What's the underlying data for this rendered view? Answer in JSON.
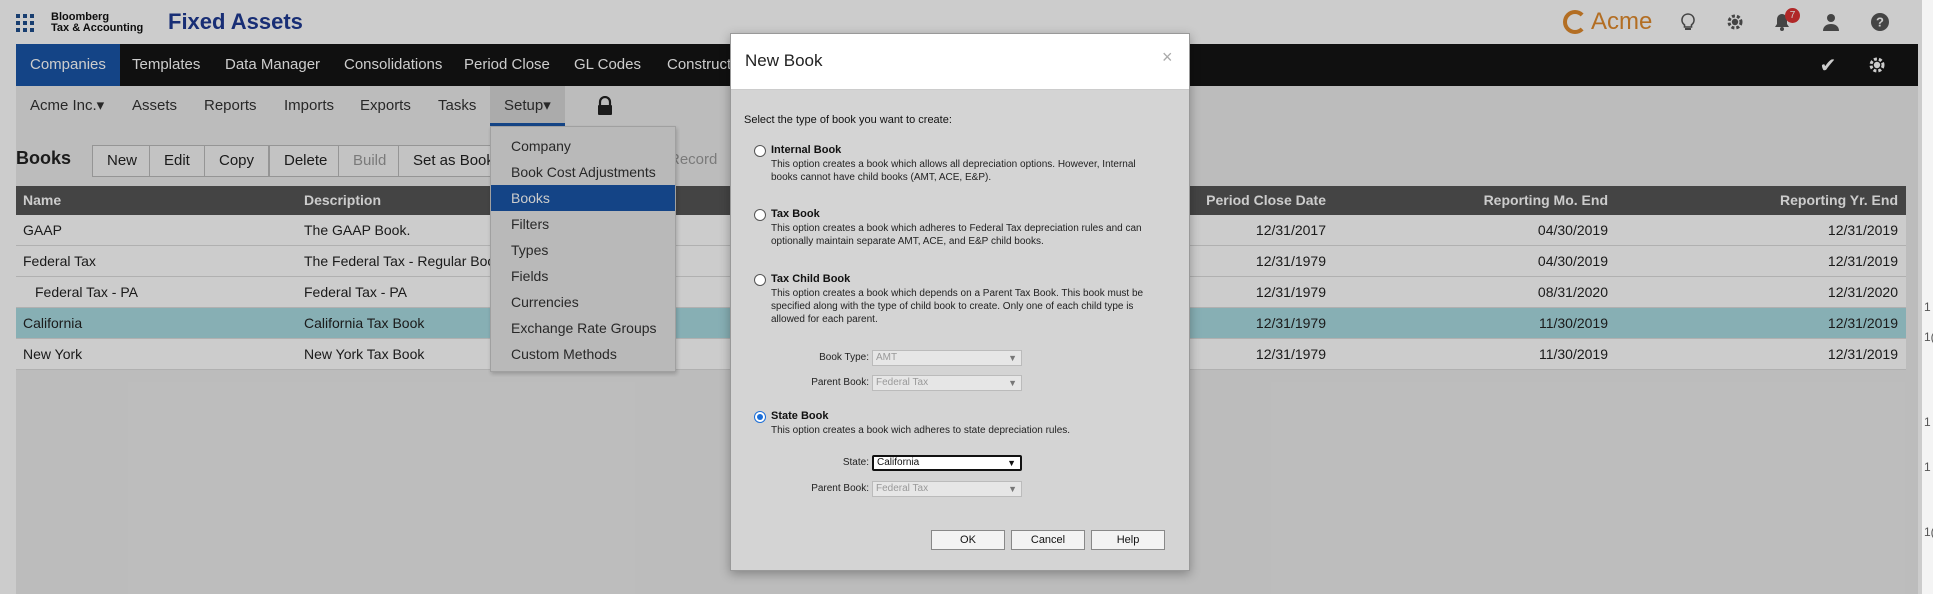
{
  "header": {
    "brand_line1": "Bloomberg",
    "brand_line2": "Tax & Accounting",
    "app_title": "Fixed Assets",
    "client_logo": "Acme",
    "notification_count": "7",
    "icons": [
      "grid-icon",
      "lightbulb-icon",
      "gear-icon",
      "bell-icon",
      "user-icon",
      "help-icon"
    ]
  },
  "mainnav": {
    "items": [
      "Companies",
      "Templates",
      "Data Manager",
      "Consolidations",
      "Period Close",
      "GL Codes",
      "Construct"
    ],
    "active": "Companies"
  },
  "subnav": {
    "items": [
      "Acme Inc.▾",
      "Assets",
      "Reports",
      "Imports",
      "Exports",
      "Tasks",
      "Setup▾"
    ],
    "active": "Setup"
  },
  "toolbar": {
    "title": "Books",
    "buttons": [
      "New",
      "Edit",
      "Copy",
      "Delete",
      "Build",
      "Set as Book",
      "Record"
    ]
  },
  "table": {
    "columns": [
      "Name",
      "Description",
      "Period Close Date",
      "Reporting Mo. End",
      "Reporting Yr. End"
    ],
    "rows": [
      {
        "name": "GAAP",
        "description": "The GAAP Book.",
        "period_close": "12/31/2017",
        "mo_end": "04/30/2019",
        "yr_end": "12/31/2019"
      },
      {
        "name": "Federal Tax",
        "description": "The Federal Tax - Regular Boo",
        "period_close": "12/31/1979",
        "mo_end": "04/30/2019",
        "yr_end": "12/31/2019"
      },
      {
        "name": "Federal Tax - PA",
        "description": "Federal Tax - PA",
        "period_close": "12/31/1979",
        "mo_end": "08/31/2020",
        "yr_end": "12/31/2020"
      },
      {
        "name": "California",
        "description": "California Tax Book",
        "period_close": "12/31/1979",
        "mo_end": "11/30/2019",
        "yr_end": "12/31/2019"
      },
      {
        "name": "New York",
        "description": "New York Tax Book",
        "period_close": "12/31/1979",
        "mo_end": "11/30/2019",
        "yr_end": "12/31/2019"
      }
    ],
    "selected_row": "California"
  },
  "setup_menu": {
    "items": [
      "Company",
      "Book Cost Adjustments",
      "Books",
      "Filters",
      "Types",
      "Fields",
      "Currencies",
      "Exchange Rate Groups",
      "Custom Methods"
    ],
    "active": "Books"
  },
  "modal": {
    "title": "New Book",
    "close": "×",
    "prompt": "Select the type of book you want to create:",
    "options": [
      {
        "label": "Internal Book",
        "desc": "This option creates a book which allows all depreciation options. However, Internal books cannot have child books (AMT, ACE, E&P).",
        "checked": false
      },
      {
        "label": "Tax Book",
        "desc": "This option creates a book which adheres to Federal Tax depreciation rules and can optionally maintain separate AMT, ACE, and E&P child books.",
        "checked": false
      },
      {
        "label": "Tax Child Book",
        "desc": "This option creates a book which depends on a Parent Tax Book. This book must be specified along with the type of child book to create. Only one of each child type is allowed for each parent.",
        "checked": false
      },
      {
        "label": "State Book",
        "desc": "This option creates a book wich adheres to state depreciation rules.",
        "checked": true
      }
    ],
    "child_fields": {
      "book_type_label": "Book Type:",
      "book_type_value": "AMT",
      "parent_book_label": "Parent Book:",
      "parent_book_value": "Federal Tax"
    },
    "state_fields": {
      "state_label": "State:",
      "state_value": "California",
      "parent_book_label": "Parent Book:",
      "parent_book_value": "Federal Tax"
    },
    "buttons": {
      "ok": "OK",
      "cancel": "Cancel",
      "help": "Help"
    }
  },
  "edge_marks": [
    "1",
    "1(",
    "1",
    "1",
    "1("
  ]
}
